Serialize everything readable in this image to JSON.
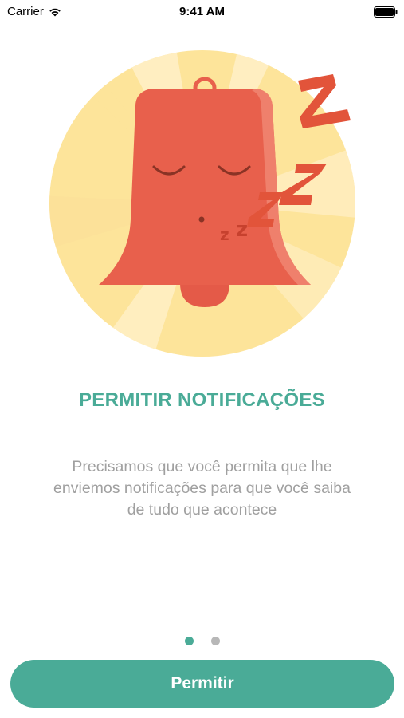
{
  "status_bar": {
    "carrier": "Carrier",
    "time": "9:41 AM"
  },
  "onboarding": {
    "illustration_icon": "sleeping-bell-icon",
    "title": "PERMITIR NOTIFICAÇÕES",
    "description": "Precisamos que você permita que lhe\nenviemos notificações  para que você saiba\nde tudo que acontece",
    "pager": {
      "current_page": 1,
      "total_pages": 2
    },
    "primary_button_label": "Permitir"
  },
  "colors": {
    "accent": "#4aab97",
    "bell": "#e8604c",
    "zzz": "#e2543a",
    "circle": "#fde49a",
    "text_muted": "#a0a0a0"
  }
}
